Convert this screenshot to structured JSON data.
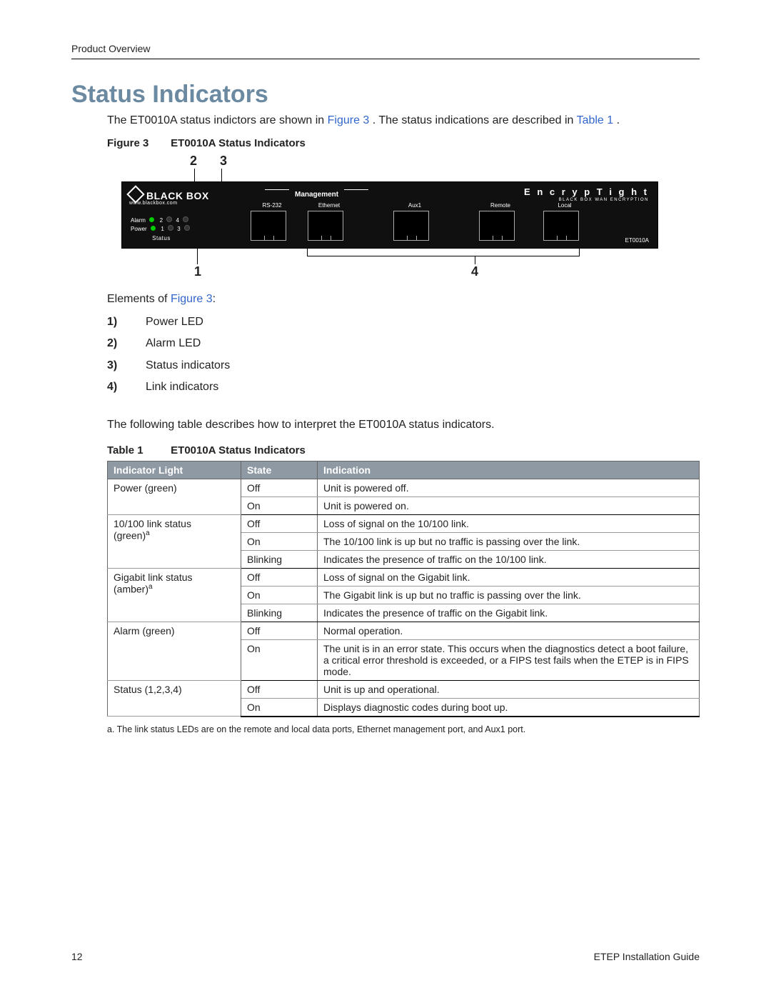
{
  "header": {
    "section": "Product Overview"
  },
  "title": "Status Indicators",
  "intro": {
    "pre": "The ET0010A status indictors are shown in ",
    "figref": "Figure 3",
    "mid": ". The status indications are described in ",
    "tblref": "Table 1",
    "post": "."
  },
  "figure": {
    "label": "Figure 3",
    "caption": "ET0010A Status Indicators",
    "annotations": {
      "n1": "1",
      "n2": "2",
      "n3": "3",
      "n4": "4"
    }
  },
  "device": {
    "brand": "BLACK BOX",
    "url": "www.blackbox.com",
    "product": "E n c r y p T i g h t",
    "product_sub": "BLACK BOX WAN ENCRYPTION",
    "model": "ET0010A",
    "mgmt_label": "Management",
    "ports": [
      "RS-232",
      "Ethernet",
      "Aux1",
      "Remote",
      "Local"
    ],
    "alarm_label": "Alarm",
    "power_label": "Power",
    "status_label": "Status",
    "leds": [
      "1",
      "2",
      "3",
      "4"
    ]
  },
  "elements": {
    "intro_pre": "Elements of ",
    "intro_ref": "Figure 3",
    "intro_post": ":",
    "items": [
      {
        "n": "1)",
        "txt": "Power LED"
      },
      {
        "n": "2)",
        "txt": "Alarm LED"
      },
      {
        "n": "3)",
        "txt": "Status indicators"
      },
      {
        "n": "4)",
        "txt": "Link indicators"
      }
    ]
  },
  "after_list": "The following table describes how to interpret the ET0010A status indicators.",
  "table": {
    "label": "Table 1",
    "caption": "ET0010A Status Indicators",
    "headers": [
      "Indicator Light",
      "State",
      "Indication"
    ],
    "rows": [
      {
        "indicator": "Power (green)",
        "state": "Off",
        "indication": "Unit is powered off.",
        "span": 2,
        "end": false
      },
      {
        "indicator": "",
        "state": "On",
        "indication": "Unit is powered on.",
        "end": true
      },
      {
        "indicator_html": "10/100 link status (green)<sup>a</sup>",
        "state": "Off",
        "indication": "Loss of signal on the 10/100 link.",
        "span": 3,
        "end": false
      },
      {
        "indicator": "",
        "state": "On",
        "indication": "The 10/100 link is up but no traffic is passing over the link.",
        "end": false
      },
      {
        "indicator": "",
        "state": "Blinking",
        "indication": "Indicates the presence of traffic on the 10/100 link.",
        "end": true
      },
      {
        "indicator_html": "Gigabit link status (amber)<sup>a</sup>",
        "state": "Off",
        "indication": "Loss of signal on the Gigabit link.",
        "span": 3,
        "end": false
      },
      {
        "indicator": "",
        "state": "On",
        "indication": "The Gigabit link is up but no traffic is passing over the link.",
        "end": false
      },
      {
        "indicator": "",
        "state": "Blinking",
        "indication": "Indicates the presence of traffic on the Gigabit link.",
        "end": true
      },
      {
        "indicator": "Alarm (green)",
        "state": "Off",
        "indication": "Normal operation.",
        "span": 2,
        "end": false
      },
      {
        "indicator": "",
        "state": "On",
        "indication": "The unit is in an error state. This occurs when the diagnostics detect a boot failure, a critical error threshold is exceeded, or a FIPS test fails when the ETEP is in FIPS mode.",
        "end": true
      },
      {
        "indicator": "Status (1,2,3,4)",
        "state": "Off",
        "indication": "Unit is up and operational.",
        "span": 2,
        "end": false
      },
      {
        "indicator": "",
        "state": "On",
        "indication": "Displays diagnostic codes during boot up.",
        "end": true,
        "tblend": true
      }
    ]
  },
  "footnote": "a.  The link status LEDs are on the remote and local data ports, Ethernet management port, and Aux1 port.",
  "footer": {
    "page": "12",
    "doc": "ETEP Installation Guide"
  }
}
